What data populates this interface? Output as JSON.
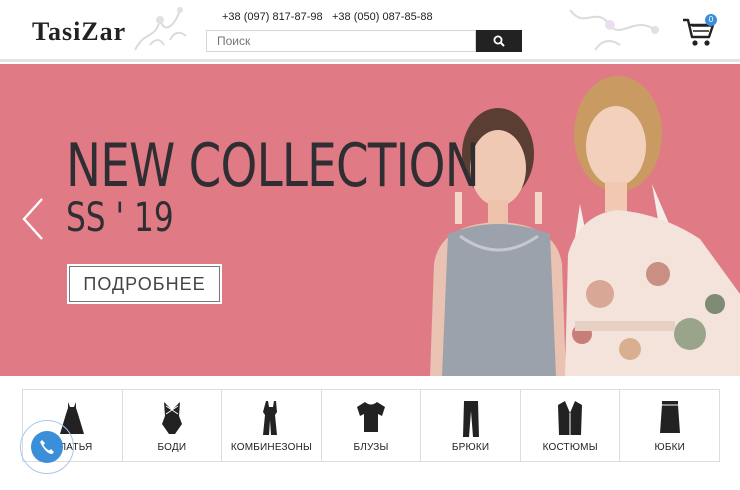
{
  "header": {
    "logo": "TasiZar",
    "phone_1": "+38 (097) 817-87-98",
    "phone_2": "+38 (050) 087-85-88",
    "search_placeholder": "Поиск",
    "cart_count": "0"
  },
  "hero": {
    "title": "NEW COLLECTION",
    "subtitle": "SS ' 19",
    "button_label": "ПОДРОБНЕЕ",
    "background_color": "#e07b86"
  },
  "categories": [
    {
      "label": "ПЛАТЬЯ",
      "icon": "dress-icon"
    },
    {
      "label": "БОДИ",
      "icon": "bodysuit-icon"
    },
    {
      "label": "КОМБИНЕЗОНЫ",
      "icon": "jumpsuit-icon"
    },
    {
      "label": "БЛУЗЫ",
      "icon": "blouse-icon"
    },
    {
      "label": "БРЮКИ",
      "icon": "trousers-icon"
    },
    {
      "label": "КОСТЮМЫ",
      "icon": "suit-icon"
    },
    {
      "label": "ЮБКИ",
      "icon": "skirt-icon"
    }
  ],
  "colors": {
    "accent": "#3a8fd8",
    "dark": "#222222"
  }
}
